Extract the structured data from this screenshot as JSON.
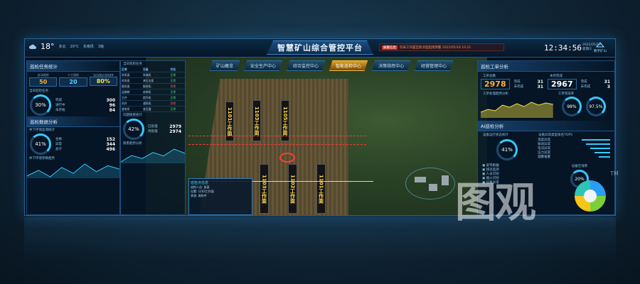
{
  "header": {
    "title": "智慧矿山综合管控平台",
    "temperature": "18°",
    "weather_items": [
      "多云",
      "20°C",
      "东南风",
      "3级"
    ],
    "alarm_tag": "报警信息",
    "alarm_text": "综采工作面瓦斯浓度超限预警 2022/05/18 10:21",
    "time": "12:34:56",
    "date_line1": "2022/05/18",
    "date_line2": "星期三",
    "brand": "数字矿山"
  },
  "nav": {
    "tabs": [
      "矿山概览",
      "安全生产中心",
      "综合监控中心",
      "智能巡检中心",
      "决策指挥中心",
      "经营管理中心"
    ],
    "active_index": 3
  },
  "left": {
    "task_title": "巡检任务统计",
    "task_stats": [
      {
        "label": "自动巡检",
        "value": "50"
      },
      {
        "label": "人工巡检",
        "value": "20"
      },
      {
        "label": "当日巡检计划完成率",
        "value": "80%"
      }
    ],
    "progress_title": "当日巡检任务",
    "progress_ring": "30%",
    "progress_items": [
      {
        "label": "完成",
        "value": "300"
      },
      {
        "label": "进行中",
        "value": "96"
      },
      {
        "label": "未开始",
        "value": "84"
      }
    ],
    "data_title": "巡检数据分析",
    "env_sub": "井下环境监测统计",
    "env_ring": "41%",
    "env_items": [
      {
        "label": "合格",
        "value": "152"
      },
      {
        "label": "异常",
        "value": "344"
      },
      {
        "label": "总计",
        "value": "496"
      }
    ],
    "trend_sub": "井下环境参数趋势",
    "trend_values": [
      42,
      55,
      40,
      62,
      48,
      70,
      52,
      66,
      58
    ]
  },
  "left2": {
    "detail_title": "当日巡检任务",
    "table_headers": [
      "区域",
      "设备",
      "状态"
    ],
    "table_rows": [
      [
        "综采面",
        "采煤机",
        "正常"
      ],
      [
        "综采面",
        "液压支架",
        "正常"
      ],
      [
        "掘进面",
        "掘进机",
        "异常"
      ],
      [
        "运输巷",
        "皮带机",
        "正常"
      ],
      [
        "主井",
        "提升机",
        "正常"
      ],
      [
        "风井",
        "通风机",
        "异常"
      ],
      [
        "变电所",
        "变压器",
        "正常"
      ]
    ],
    "fault_sub": "问题隐患统计",
    "fault_ring": "42%",
    "fault_items": [
      {
        "label": "已处理",
        "value": "2979"
      },
      {
        "label": "待处理",
        "value": "2974"
      }
    ],
    "trend_sub": "隐患趋势分析",
    "trend_values": [
      30,
      45,
      38,
      52,
      44,
      60,
      50
    ]
  },
  "map": {
    "face_labels": [
      "1101工作面",
      "1103工作面",
      "1105工作面",
      "1103工作面",
      "1102工作面",
      "1101工作面"
    ],
    "popup_title": "巡检点信息",
    "popup_rows": [
      "巡检人员: 张某",
      "位置: 1103工作面",
      "状态: 巡检中"
    ]
  },
  "right": {
    "order_title": "巡检工单分析",
    "order_sub1": "工单总数",
    "order_total": "2978",
    "order_sub2": "本月完成",
    "order_month": "2967",
    "order_kv1": [
      {
        "label": "完成",
        "value": "31"
      },
      {
        "label": "未完成",
        "value": "31"
      }
    ],
    "order_kv2": [
      {
        "label": "完成",
        "value": "31"
      },
      {
        "label": "未完成",
        "value": "3"
      }
    ],
    "trend_sub": "工单处理趋势分析",
    "rate_sub": "工单完成率",
    "rate_a": "98%",
    "rate_b": "97.5%",
    "ai_title": "AI巡检分析",
    "ai_sub1": "设备运行状态统计",
    "ai_ring1": "41%",
    "ai_sub2": "设备异常类型排名TOP5",
    "ai_ranks": [
      "温度异常",
      "振动异常",
      "电流异常",
      "压力异常",
      "烟雾报警"
    ],
    "ai_checks": [
      "皮带跑偏",
      "煤流监测",
      "人员识别",
      "烟火识别",
      "设备异常"
    ],
    "ai_ring2_label": "设备在线率",
    "ai_ring2": "20%",
    "colors": {
      "accent": "#38c8ff",
      "orange": "#ffb03a",
      "yellow": "#f4e04a",
      "green": "#5ee07a",
      "red": "#ff6a5a"
    }
  },
  "watermark": {
    "text": "图观",
    "tm": "TM"
  }
}
